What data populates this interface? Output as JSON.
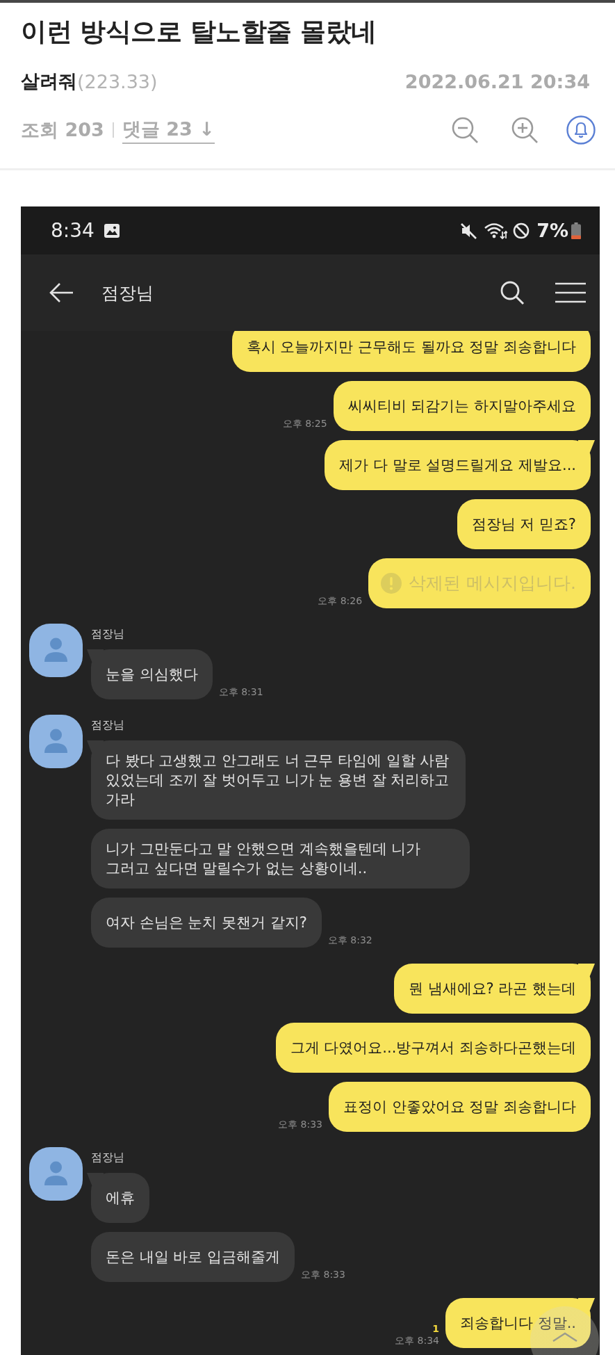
{
  "post": {
    "title": "이런 방식으로 탈노할줄 몰랐네",
    "author": "살려줘",
    "author_score": "(223.33)",
    "date": "2022.06.21 20:34",
    "views": "조회 203",
    "comments_link": "댓글 23 ↓"
  },
  "status_bar": {
    "time": "8:34",
    "battery": "7%"
  },
  "chat": {
    "title": "점장님",
    "messages": [
      {
        "kind": "sent",
        "text": "혹시 오늘까지만 근무해도 될까요 정말 죄송합니다",
        "tail": false
      },
      {
        "kind": "sent",
        "text": "씨씨티비 되감기는 하지말아주세요",
        "tail": false,
        "time": "오후 8:25"
      },
      {
        "kind": "sent",
        "text": "제가 다 말로 설명드릴게요 제발요...",
        "tail": true
      },
      {
        "kind": "sent",
        "text": "점장님 저 믿죠?",
        "tail": false
      },
      {
        "kind": "deleted",
        "text": "삭제된 메시지입니다.",
        "tail": false,
        "time": "오후 8:26"
      },
      {
        "kind": "received",
        "sender": "점장님",
        "text": "눈을 의심했다",
        "tail": true,
        "time": "오후 8:31"
      },
      {
        "kind": "received",
        "sender": "점장님",
        "text": "다 봤다 고생했고 안그래도 너 근무 타임에 일할 사람 있었는데 조끼 잘 벗어두고 니가 눈 용변 잘 처리하고 가라",
        "tail": true
      },
      {
        "kind": "received",
        "text": "니가 그만둔다고 말 안했으면 계속했을텐데 니가 그러고 싶다면 말릴수가 없는 상황이네..",
        "tail": false
      },
      {
        "kind": "received",
        "text": "여자 손님은 눈치 못챈거 같지?",
        "tail": false,
        "time": "오후 8:32"
      },
      {
        "kind": "sent",
        "text": "뭔 냄새에요? 라곤 했는데",
        "tail": true
      },
      {
        "kind": "sent",
        "text": "그게 다였어요...방구껴서 죄송하다곤했는데",
        "tail": false
      },
      {
        "kind": "sent",
        "text": "표정이 안좋았어요 정말 죄송합니다",
        "tail": false,
        "time": "오후 8:33"
      },
      {
        "kind": "received",
        "sender": "점장님",
        "text": "에휴",
        "tail": true
      },
      {
        "kind": "received",
        "text": "돈은 내일 바로 입금해줄게",
        "tail": false,
        "time": "오후 8:33"
      },
      {
        "kind": "sent",
        "text": "죄송합니다 정말..",
        "tail": true,
        "unread": "1",
        "time": "오후 8:34"
      }
    ]
  }
}
